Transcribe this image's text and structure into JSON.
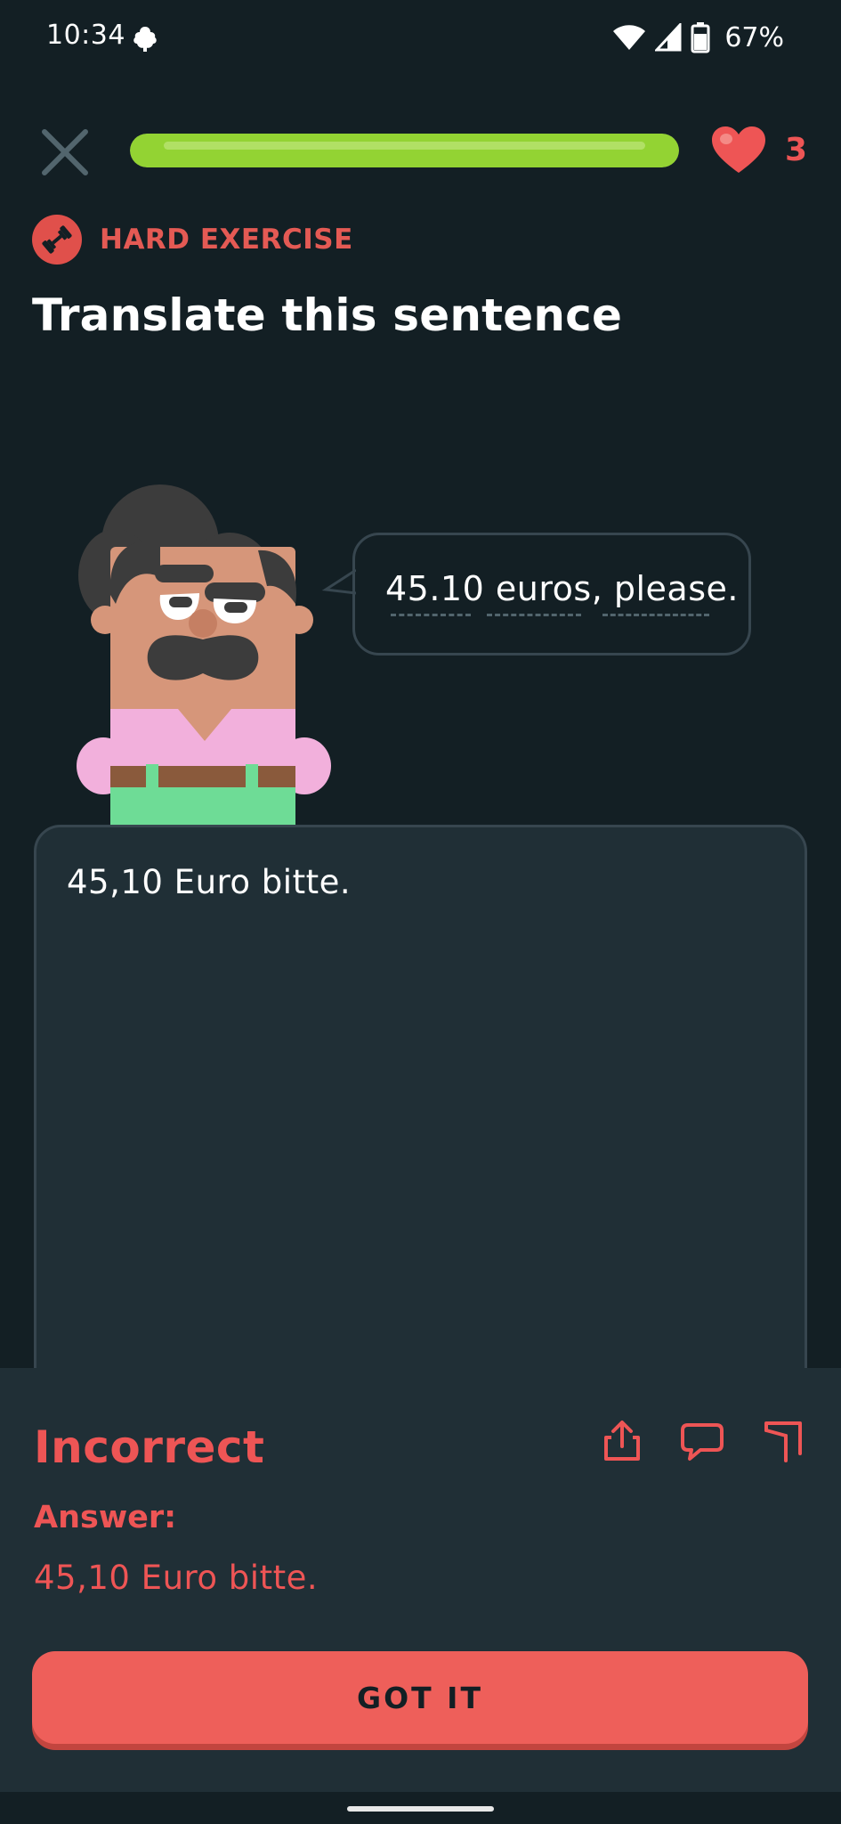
{
  "status_bar": {
    "time": "10:34",
    "battery": "67%",
    "icons": [
      "notification-icon",
      "wifi-icon",
      "signal-icon",
      "battery-icon"
    ]
  },
  "header": {
    "progress_fraction": 1.0,
    "hearts": "3",
    "icons": [
      "close-icon",
      "heart-icon"
    ]
  },
  "exercise": {
    "difficulty_label": "HARD EXERCISE",
    "title": "Translate this sentence",
    "prompt_words": [
      "45.10",
      "euros,",
      "please."
    ],
    "icon": "dumbbell-icon"
  },
  "answer_input": {
    "value": "45,10 Euro bitte."
  },
  "feedback": {
    "status": "Incorrect",
    "answer_heading": "Answer:",
    "answer_text": "45,10 Euro bitte.",
    "button_label": "GOT IT",
    "icons": [
      "share-icon",
      "comment-icon",
      "flag-icon"
    ]
  },
  "colors": {
    "background": "#131f24",
    "panel": "#202f36",
    "error": "#ee5555",
    "progress": "#93d333",
    "button": "#ee5f5a"
  }
}
